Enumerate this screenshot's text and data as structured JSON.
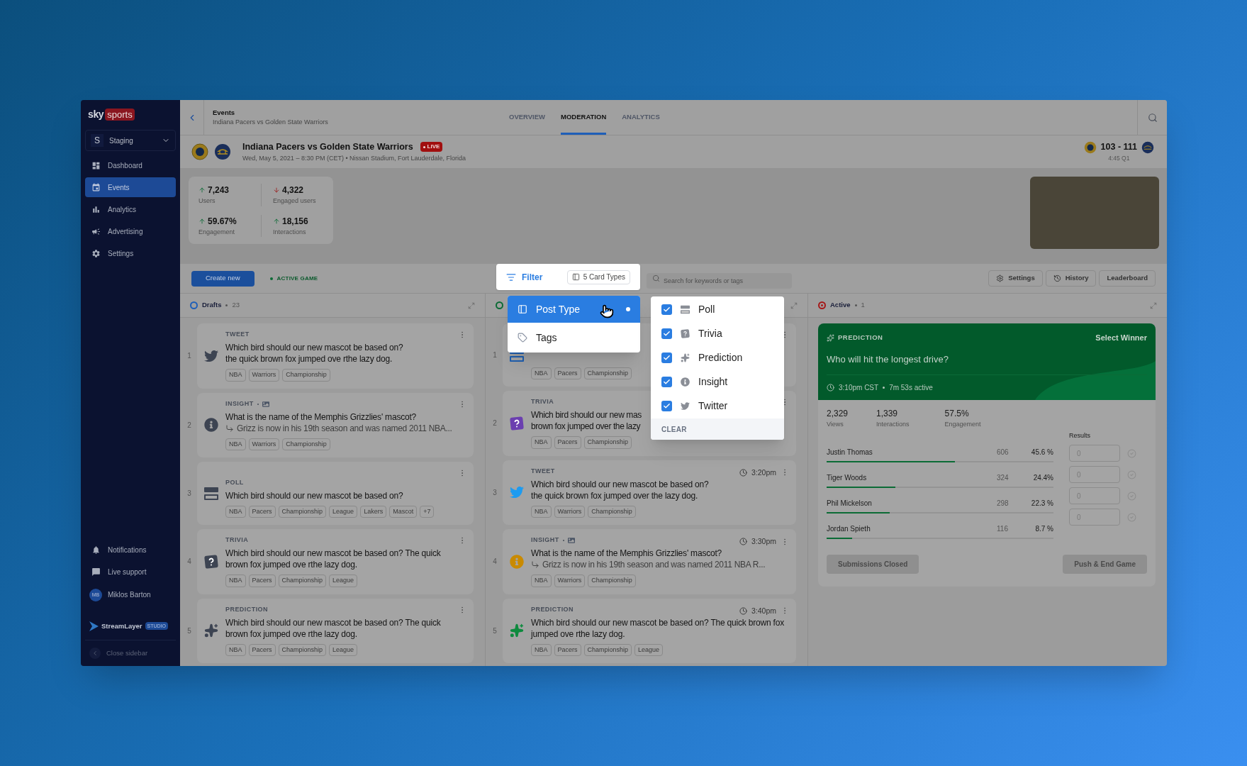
{
  "sidebar": {
    "brand": {
      "first": "sky",
      "second": "sports"
    },
    "workspace": {
      "initial": "S",
      "name": "Staging"
    },
    "nav": [
      {
        "kind": "dashboard",
        "label": "Dashboard",
        "selected": false
      },
      {
        "kind": "events",
        "label": "Events",
        "selected": true
      },
      {
        "kind": "analytics",
        "label": "Analytics",
        "selected": false
      },
      {
        "kind": "advertising",
        "label": "Advertising",
        "selected": false
      },
      {
        "kind": "settings",
        "label": "Settings",
        "selected": false
      }
    ],
    "bottom": [
      {
        "kind": "notifications",
        "label": "Notifications"
      },
      {
        "kind": "support",
        "label": "Live support"
      }
    ],
    "user": {
      "initials": "MB",
      "name": "Miklos Barton"
    },
    "studio": {
      "name": "StreamLayer",
      "badge": "STUDIO"
    },
    "close": "Close sidebar"
  },
  "header": {
    "section": "Events",
    "subtitle": "Indiana Pacers vs Golden State Warriors",
    "tabs": [
      {
        "label": "OVERVIEW",
        "selected": false
      },
      {
        "label": "MODERATION",
        "selected": true
      },
      {
        "label": "ANALYTICS",
        "selected": false
      }
    ]
  },
  "event": {
    "title": "Indiana Pacers vs Golden State Warriors",
    "live": "LIVE",
    "meta": "Wed, May 5, 2021 – 8:30 PM (CET) • Nissan Stadium, Fort Lauderdale, Florida",
    "score": "103 - 111",
    "clock": "4:45 Q1"
  },
  "stats": [
    {
      "value": "7,243",
      "label": "Users",
      "rising": true
    },
    {
      "value": "4,322",
      "label": "Engaged users",
      "rising": false
    },
    {
      "value": "59.67%",
      "label": "Engagement",
      "rising": true
    },
    {
      "value": "18,156",
      "label": "Interactions",
      "rising": true
    }
  ],
  "toolbar": {
    "create": "Create new",
    "status": "ACTIVE GAME",
    "filter": "Filter",
    "card_types": "5 Card Types",
    "search_placeholder": "Search for keywords or tags",
    "buttons": [
      {
        "kind": "settings",
        "label": "Settings"
      },
      {
        "kind": "history",
        "label": "History"
      },
      {
        "kind": "plain",
        "label": "Leaderboard"
      }
    ]
  },
  "filter_menu": {
    "items": [
      {
        "kind": "post_type",
        "label": "Post Type",
        "selected": true
      },
      {
        "kind": "tags",
        "label": "Tags",
        "selected": false
      }
    ],
    "options": [
      {
        "kind": "poll",
        "label": "Poll",
        "checked": true
      },
      {
        "kind": "trivia",
        "label": "Trivia",
        "checked": true
      },
      {
        "kind": "prediction",
        "label": "Prediction",
        "checked": true
      },
      {
        "kind": "insight",
        "label": "Insight",
        "checked": true
      },
      {
        "kind": "tweet",
        "label": "Twitter",
        "checked": true
      }
    ],
    "clear": "CLEAR"
  },
  "columns": [
    {
      "kind": "drafts",
      "title": "Drafts",
      "count": "23",
      "cards": [
        {
          "index": "1",
          "kind": "tweet",
          "label": "TWEET",
          "has_image": false,
          "question": "Which bird should our new mascot be based on?\nthe quick brown fox jumped ove rthe lazy dog.",
          "tags": [
            "NBA",
            "Warriors",
            "Championship"
          ]
        },
        {
          "index": "2",
          "kind": "insight",
          "label": "INSIGHT",
          "has_image": true,
          "question": "What is the name of the Memphis Grizzlies' mascot?",
          "answer": "Grizz is now in his 19th season and was named 2011 NBA...",
          "tags": [
            "NBA",
            "Warriors",
            "Championship"
          ]
        },
        {
          "index": "3",
          "kind": "poll",
          "label": "POLL",
          "has_image": false,
          "question": "Which bird should our new mascot be based on?",
          "tags": [
            "NBA",
            "Pacers",
            "Championship",
            "League",
            "Lakers",
            "Mascot",
            "+7"
          ]
        },
        {
          "index": "4",
          "kind": "trivia",
          "label": "TRIVIA",
          "has_image": false,
          "question": "Which bird should our new mascot be based on? The quick brown fox jumped ove rthe lazy dog.",
          "tags": [
            "NBA",
            "Pacers",
            "Championship",
            "League"
          ]
        },
        {
          "index": "5",
          "kind": "prediction",
          "label": "PREDICTION",
          "has_image": false,
          "question": "Which bird should our new mascot be based on? The quick brown fox jumped ove rthe lazy dog.",
          "tags": [
            "NBA",
            "Pacers",
            "Championship",
            "League"
          ]
        }
      ]
    },
    {
      "kind": "scheduled",
      "cards": [
        {
          "index": "1",
          "kind": "poll",
          "has_image": false,
          "tags": [
            "NBA",
            "Pacers",
            "Championship"
          ]
        },
        {
          "index": "2",
          "kind": "trivia",
          "label": "TRIVIA",
          "has_image": false,
          "question": "Which bird should our new mas\nbrown fox jumped over the lazy",
          "tags": [
            "NBA",
            "Pacers",
            "Championship"
          ]
        },
        {
          "index": "3",
          "kind": "tweet",
          "label": "TWEET",
          "time": "3:20pm",
          "has_image": false,
          "question": "Which bird should our new mascot be based on?\nthe quick brown fox jumped over the lazy dog.",
          "tags": [
            "NBA",
            "Warriors",
            "Championship"
          ]
        },
        {
          "index": "4",
          "kind": "insight",
          "label": "INSIGHT",
          "time": "3:30pm",
          "has_image": true,
          "question": "What is the name of the Memphis Grizzlies' mascot?",
          "answer": "Grizz is now in his 19th season and was named 2011 NBA R...",
          "tags": [
            "NBA",
            "Warriors",
            "Championship"
          ]
        },
        {
          "index": "5",
          "kind": "prediction",
          "label": "PREDICTION",
          "time": "3:40pm",
          "has_image": false,
          "question": "Which bird should our new mascot be based on? The quick brown fox jumped ove rthe lazy dog.",
          "tags": [
            "NBA",
            "Pacers",
            "Championship",
            "League"
          ]
        }
      ]
    },
    {
      "kind": "active",
      "title": "Active",
      "count": "1",
      "active_card": {
        "label": "PREDICTION",
        "action": "Select Winner",
        "question": "Who will hit the longest drive?",
        "time": "3:10pm CST",
        "duration": "7m 53s active",
        "metrics": [
          {
            "value": "2,329",
            "label": "Views"
          },
          {
            "value": "1,339",
            "label": "Interactions"
          },
          {
            "value": "57.5%",
            "label": "Engagement"
          }
        ],
        "results_label": "Results",
        "options": [
          {
            "name": "Justin Thomas",
            "votes": "606",
            "percent": "45.6 %",
            "level": 0.566,
            "placeholder": "0"
          },
          {
            "name": "Tiger Woods",
            "votes": "324",
            "percent": "24.4%",
            "level": 0.304,
            "placeholder": "0"
          },
          {
            "name": "Phil Mickelson",
            "votes": "298",
            "percent": "22.3 %",
            "level": 0.278,
            "placeholder": "0"
          },
          {
            "name": "Jordan Spieth",
            "votes": "116",
            "percent": "8.7 %",
            "level": 0.111,
            "placeholder": "0"
          }
        ],
        "buttons": [
          "Submissions Closed",
          "Push & End Game"
        ]
      }
    }
  ]
}
